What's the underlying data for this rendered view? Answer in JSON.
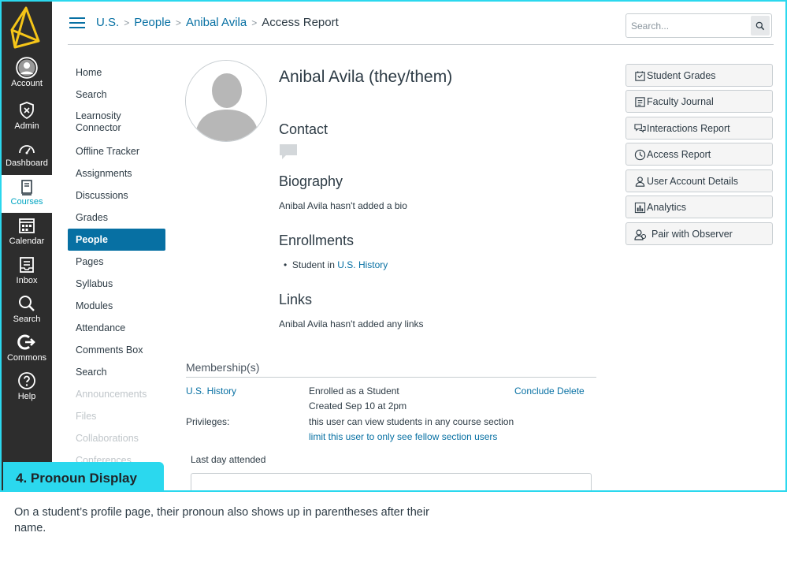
{
  "global_nav": {
    "items": [
      {
        "label": "Account",
        "icon": "account-icon"
      },
      {
        "label": "Admin",
        "icon": "admin-icon"
      },
      {
        "label": "Dashboard",
        "icon": "dashboard-icon"
      },
      {
        "label": "Courses",
        "icon": "courses-icon",
        "active": true
      },
      {
        "label": "Calendar",
        "icon": "calendar-icon"
      },
      {
        "label": "Inbox",
        "icon": "inbox-icon"
      },
      {
        "label": "Search",
        "icon": "search-icon"
      },
      {
        "label": "Commons",
        "icon": "commons-icon"
      },
      {
        "label": "Help",
        "icon": "help-icon"
      }
    ],
    "colors": {
      "background": "#2d2d2d",
      "active_text": "#00a5c2",
      "logo": "#f5c518"
    }
  },
  "breadcrumbs": [
    {
      "label": "U.S.",
      "link": true
    },
    {
      "label": "People",
      "link": true
    },
    {
      "label": "Anibal Avila",
      "link": true
    },
    {
      "label": "Access Report",
      "link": false
    }
  ],
  "search": {
    "placeholder": "Search..."
  },
  "course_nav": {
    "items": [
      {
        "label": "Home"
      },
      {
        "label": "Search"
      },
      {
        "label": "Learnosity Connector"
      },
      {
        "label": "Offline Tracker"
      },
      {
        "label": "Assignments"
      },
      {
        "label": "Discussions"
      },
      {
        "label": "Grades"
      },
      {
        "label": "People",
        "active": true
      },
      {
        "label": "Pages"
      },
      {
        "label": "Syllabus"
      },
      {
        "label": "Modules"
      },
      {
        "label": "Attendance"
      },
      {
        "label": "Comments Box"
      },
      {
        "label": "Search"
      },
      {
        "label": "Announcements",
        "disabled": true
      },
      {
        "label": "Files",
        "disabled": true
      },
      {
        "label": "Collaborations",
        "disabled": true
      },
      {
        "label": "Conferences",
        "disabled": true
      }
    ]
  },
  "profile": {
    "name": "Anibal Avila (they/them)",
    "contact_heading": "Contact",
    "biography_heading": "Biography",
    "biography_text": "Anibal Avila hasn't added a bio",
    "enrollments_heading": "Enrollments",
    "enrollment_prefix": "Student in",
    "enrollment_course": "U.S. History",
    "links_heading": "Links",
    "links_text": "Anibal Avila hasn't added any links"
  },
  "membership": {
    "title": "Membership(s)",
    "course": "U.S. History",
    "role": "Enrolled as a Student",
    "created": "Created Sep 10 at 2pm",
    "conclude": "Conclude",
    "delete": "Delete",
    "privileges_label": "Privileges:",
    "privileges_text": "this user can view students in any course section",
    "limit_link": "limit this user to only see fellow section users",
    "last_day_label": "Last day attended"
  },
  "side_buttons": [
    {
      "label": "Student Grades",
      "icon": "grades-icon"
    },
    {
      "label": "Faculty Journal",
      "icon": "journal-icon"
    },
    {
      "label": "Interactions Report",
      "icon": "interactions-icon"
    },
    {
      "label": "Access Report",
      "icon": "clock-icon"
    },
    {
      "label": "User Account Details",
      "icon": "user-icon"
    },
    {
      "label": "Analytics",
      "icon": "analytics-icon"
    },
    {
      "label": "Pair with Observer",
      "icon": "observer-icon"
    }
  ],
  "caption": {
    "tab": "4.  Pronoun Display",
    "description": "On a student’s profile page, their pronoun also shows up in parentheses after their name.",
    "color": "#2bd8ee"
  }
}
